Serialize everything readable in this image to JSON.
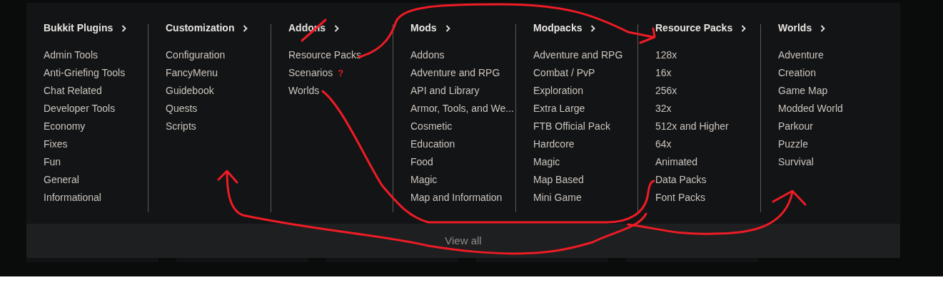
{
  "menu": {
    "columns": [
      {
        "title": "Bukkit Plugins",
        "items": [
          {
            "label": "Admin Tools"
          },
          {
            "label": "Anti-Griefing Tools"
          },
          {
            "label": "Chat Related"
          },
          {
            "label": "Developer Tools"
          },
          {
            "label": "Economy"
          },
          {
            "label": "Fixes"
          },
          {
            "label": "Fun"
          },
          {
            "label": "General"
          },
          {
            "label": "Informational"
          }
        ]
      },
      {
        "title": "Customization",
        "items": [
          {
            "label": "Configuration"
          },
          {
            "label": "FancyMenu"
          },
          {
            "label": "Guidebook"
          },
          {
            "label": "Quests"
          },
          {
            "label": "Scripts"
          }
        ]
      },
      {
        "title": "Addons",
        "items": [
          {
            "label": "Resource Packs"
          },
          {
            "label": "Scenarios",
            "note": "?"
          },
          {
            "label": "Worlds"
          }
        ]
      },
      {
        "title": "Mods",
        "items": [
          {
            "label": "Addons"
          },
          {
            "label": "Adventure and RPG"
          },
          {
            "label": "API and Library"
          },
          {
            "label": "Armor, Tools, and We..."
          },
          {
            "label": "Cosmetic"
          },
          {
            "label": "Education"
          },
          {
            "label": "Food"
          },
          {
            "label": "Magic"
          },
          {
            "label": "Map and Information"
          }
        ]
      },
      {
        "title": "Modpacks",
        "items": [
          {
            "label": "Adventure and RPG"
          },
          {
            "label": "Combat / PvP"
          },
          {
            "label": "Exploration"
          },
          {
            "label": "Extra Large"
          },
          {
            "label": "FTB Official Pack"
          },
          {
            "label": "Hardcore"
          },
          {
            "label": "Magic"
          },
          {
            "label": "Map Based"
          },
          {
            "label": "Mini Game"
          }
        ]
      },
      {
        "title": "Resource Packs",
        "items": [
          {
            "label": "128x"
          },
          {
            "label": "16x"
          },
          {
            "label": "256x"
          },
          {
            "label": "32x"
          },
          {
            "label": "512x and Higher"
          },
          {
            "label": "64x"
          },
          {
            "label": "Animated"
          },
          {
            "label": "Data Packs"
          },
          {
            "label": "Font Packs"
          }
        ]
      },
      {
        "title": "Worlds",
        "items": [
          {
            "label": "Adventure"
          },
          {
            "label": "Creation"
          },
          {
            "label": "Game Map"
          },
          {
            "label": "Modded World"
          },
          {
            "label": "Parkour"
          },
          {
            "label": "Puzzle"
          },
          {
            "label": "Survival"
          }
        ]
      }
    ],
    "footer": "View all"
  }
}
